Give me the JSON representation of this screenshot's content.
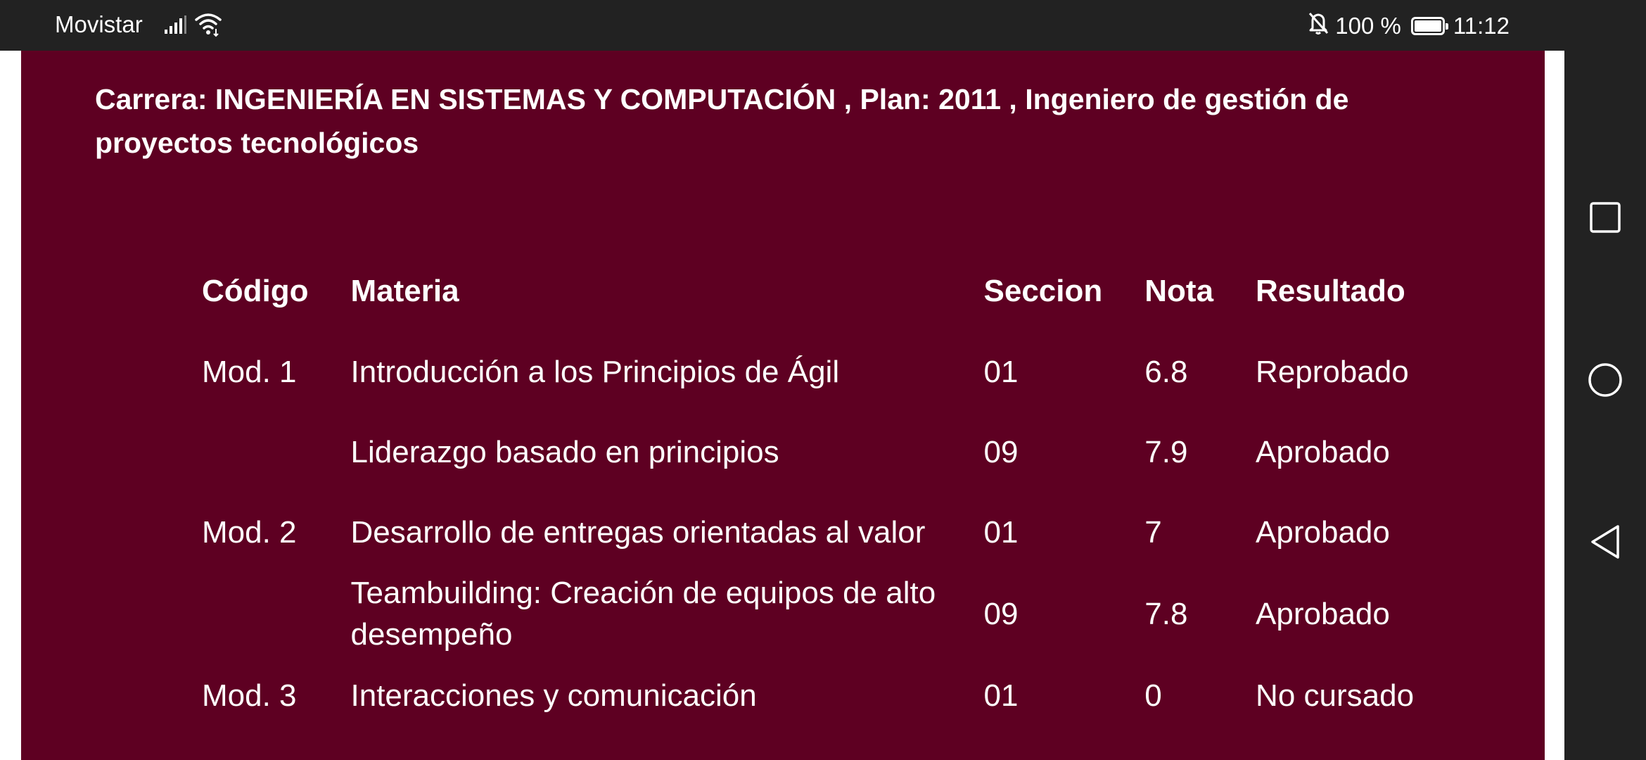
{
  "status_bar": {
    "carrier": "Movistar",
    "battery_percent": "100 %",
    "time": "11:12",
    "icons": [
      "signal-icon",
      "wifi-icon",
      "mute-bell-icon",
      "battery-icon"
    ]
  },
  "career": {
    "title": "Carrera: INGENIERÍA EN SISTEMAS Y COMPUTACIÓN , Plan: 2011 , Ingeniero de gestión de proyectos tecnológicos"
  },
  "table": {
    "headers": {
      "code": "Código",
      "subject": "Materia",
      "section": "Seccion",
      "grade": "Nota",
      "result": "Resultado"
    },
    "rows": [
      {
        "code": "Mod. 1",
        "subject": "Introducción a los Principios de Ágil",
        "section": "01",
        "grade": "6.8",
        "result": "Reprobado"
      },
      {
        "code": "",
        "subject": "Liderazgo basado en principios",
        "section": "09",
        "grade": "7.9",
        "result": "Aprobado"
      },
      {
        "code": "Mod. 2",
        "subject": "Desarrollo de entregas orientadas al valor",
        "section": "01",
        "grade": "7",
        "result": "Aprobado"
      },
      {
        "code": "",
        "subject": "Teambuilding: Creación de equipos de alto desempeño",
        "section": "09",
        "grade": "7.8",
        "result": "Aprobado"
      },
      {
        "code": "Mod. 3",
        "subject": "Interacciones y comunicación",
        "section": "01",
        "grade": "0",
        "result": "No cursado"
      }
    ]
  },
  "nav_bar": {
    "buttons": [
      "recent-apps-icon",
      "home-icon",
      "back-icon"
    ]
  },
  "colors": {
    "card_background": "#5e0022",
    "system_bar": "#222222",
    "text": "#ffffff"
  }
}
